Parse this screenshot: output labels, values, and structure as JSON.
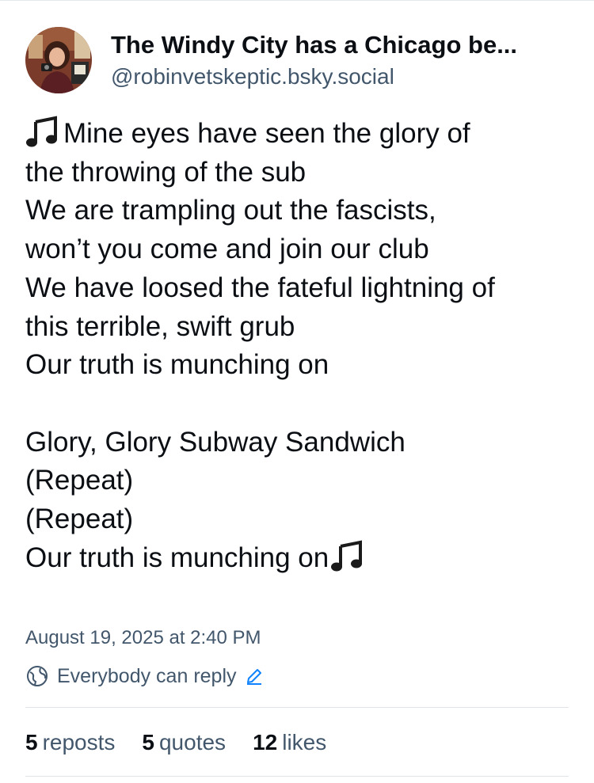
{
  "post": {
    "author": {
      "display_name": "The Windy City has a Chicago be...",
      "handle": "@robinvetskeptic.bsky.social",
      "avatar_icon": "profile-photo"
    },
    "body_lines": [
      "Mine eyes have seen the glory of",
      "the throwing of the sub",
      "We are trampling out the fascists,",
      "won’t you come and join our club",
      "We have loosed the fateful lightning of",
      "this terrible, swift grub",
      "Our truth is munching on",
      "",
      "Glory, Glory Subway Sandwich",
      "(Repeat)",
      "(Repeat)",
      "Our truth is munching on"
    ],
    "emoji": "musical-notes-icon",
    "timestamp": "August 19, 2025 at 2:40 PM",
    "reply_setting": "Everybody can reply",
    "stats": {
      "reposts_count": "5",
      "reposts_label": "reposts",
      "quotes_count": "5",
      "quotes_label": "quotes",
      "likes_count": "12",
      "likes_label": "likes"
    }
  },
  "colors": {
    "text_primary": "#0b0f14",
    "text_secondary": "#42576c",
    "accent": "#1083fe",
    "divider": "#e0e4e8"
  }
}
